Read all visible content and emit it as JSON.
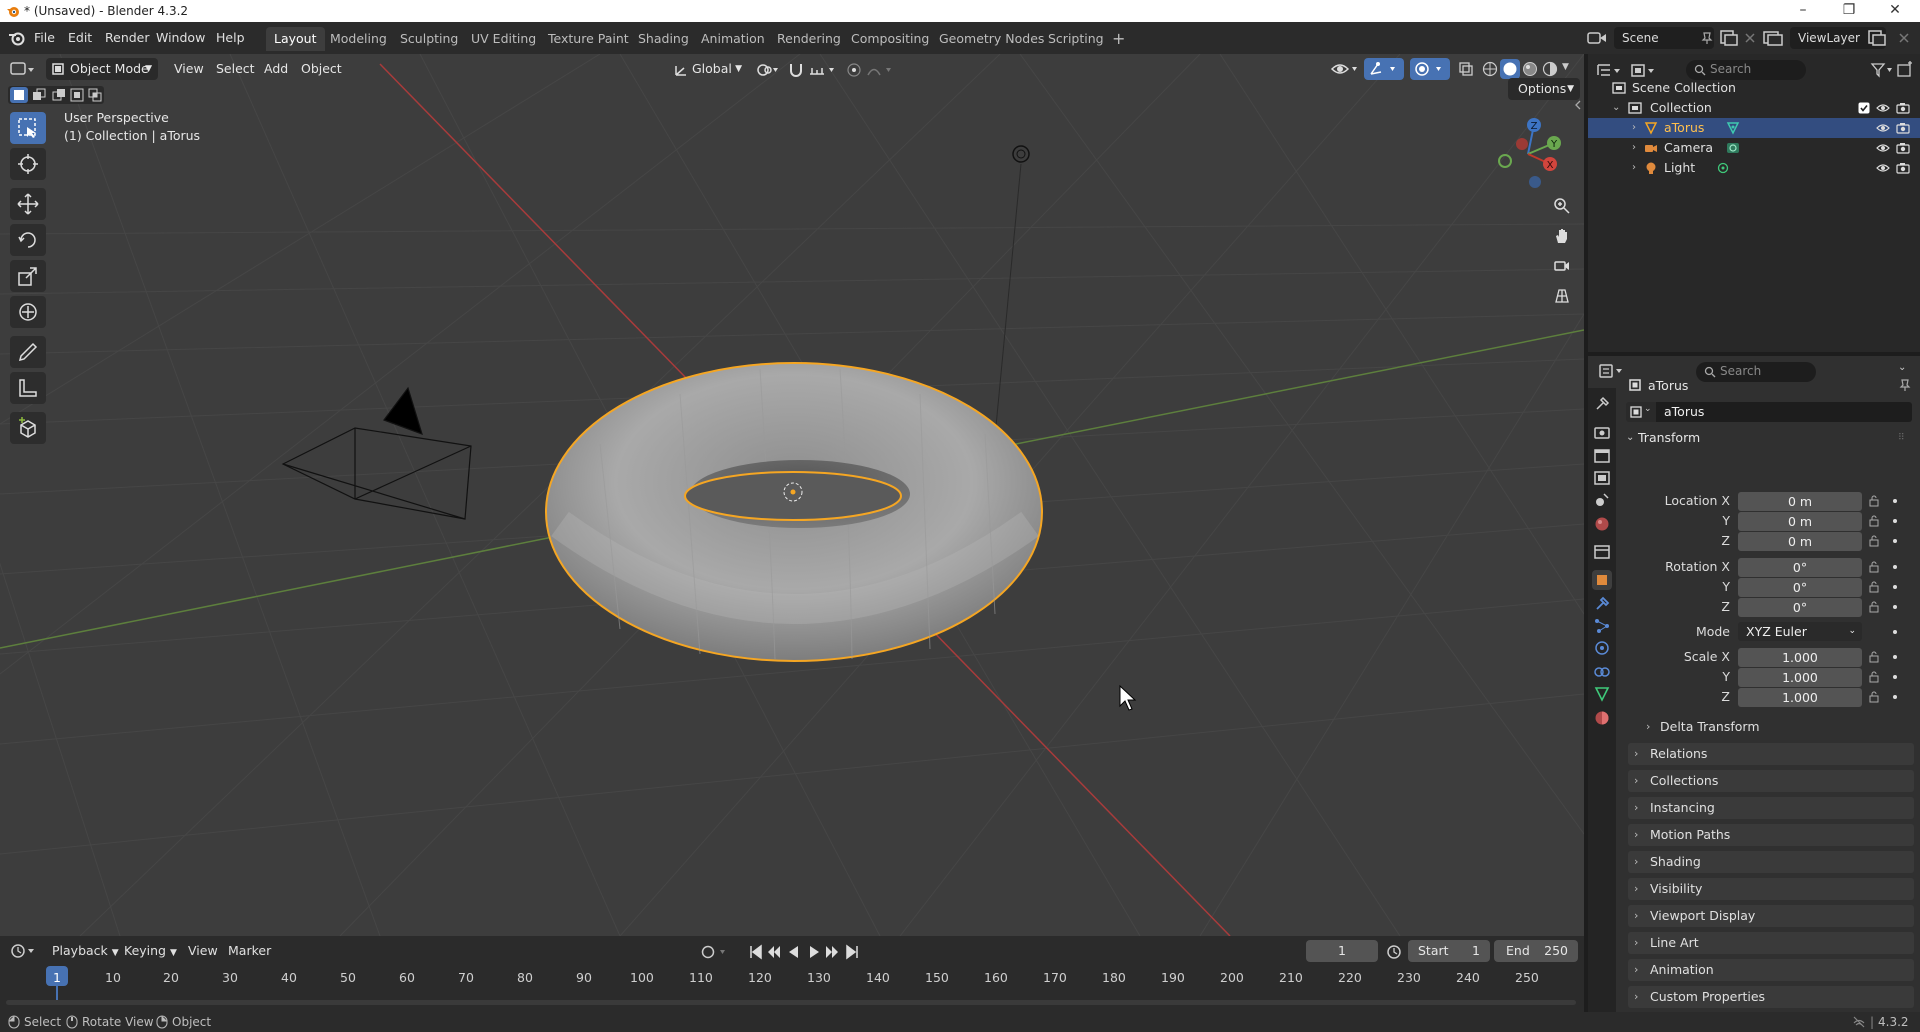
{
  "window": {
    "title": "* (Unsaved) - Blender 4.3.2",
    "minimize": "–",
    "maximize": "❐",
    "close": "✕"
  },
  "menu": [
    "File",
    "Edit",
    "Render",
    "Window",
    "Help"
  ],
  "workspaces": [
    "Layout",
    "Modeling",
    "Sculpting",
    "UV Editing",
    "Texture Paint",
    "Shading",
    "Animation",
    "Rendering",
    "Compositing",
    "Geometry Nodes",
    "Scripting"
  ],
  "active_workspace": "Layout",
  "add_workspace": "+",
  "scene": {
    "name": "Scene",
    "view_layer": "ViewLayer"
  },
  "viewport": {
    "mode": "Object Mode",
    "menus": [
      "View",
      "Select",
      "Add",
      "Object"
    ],
    "orientation": "Global",
    "options": "Options",
    "info_line1": "User Perspective",
    "info_line2": "(1) Collection | aTorus",
    "gizmo": {
      "x": "X",
      "y": "Y",
      "z": "Z"
    }
  },
  "outliner": {
    "search_placeholder": "Search",
    "scene_collection": "Scene Collection",
    "collection": "Collection",
    "objects": [
      "aTorus",
      "Camera",
      "Light"
    ],
    "selected": "aTorus"
  },
  "properties": {
    "search_placeholder": "Search",
    "object_name": "aTorus",
    "data_name": "aTorus",
    "transform_label": "Transform",
    "location_label": "Location X",
    "rotation_label": "Rotation X",
    "scale_label": "Scale X",
    "y_label": "Y",
    "z_label": "Z",
    "mode_label": "Mode",
    "location": [
      "0 m",
      "0 m",
      "0 m"
    ],
    "rotation": [
      "0°",
      "0°",
      "0°"
    ],
    "rotation_mode": "XYZ Euler",
    "scale": [
      "1.000",
      "1.000",
      "1.000"
    ],
    "delta_transform": "Delta Transform",
    "panels": [
      "Relations",
      "Collections",
      "Instancing",
      "Motion Paths",
      "Shading",
      "Visibility",
      "Viewport Display",
      "Line Art",
      "Animation",
      "Custom Properties"
    ]
  },
  "timeline": {
    "menus": [
      "Playback",
      "Keying",
      "View",
      "Marker"
    ],
    "current_frame": "1",
    "start_label": "Start",
    "start": "1",
    "end_label": "End",
    "end": "250",
    "ticks": [
      "1",
      "10",
      "20",
      "30",
      "40",
      "50",
      "60",
      "70",
      "80",
      "90",
      "100",
      "110",
      "120",
      "130",
      "140",
      "150",
      "160",
      "170",
      "180",
      "190",
      "200",
      "210",
      "220",
      "230",
      "240",
      "250"
    ]
  },
  "status": {
    "select": "Select",
    "rotate_view": "Rotate View",
    "object": "Object",
    "version": "4.3.2"
  },
  "colors": {
    "selection_outline": "#f5a623",
    "active_blue": "#4772b3",
    "x_axis": "#c0392b",
    "y_axis": "#6aa84f"
  }
}
